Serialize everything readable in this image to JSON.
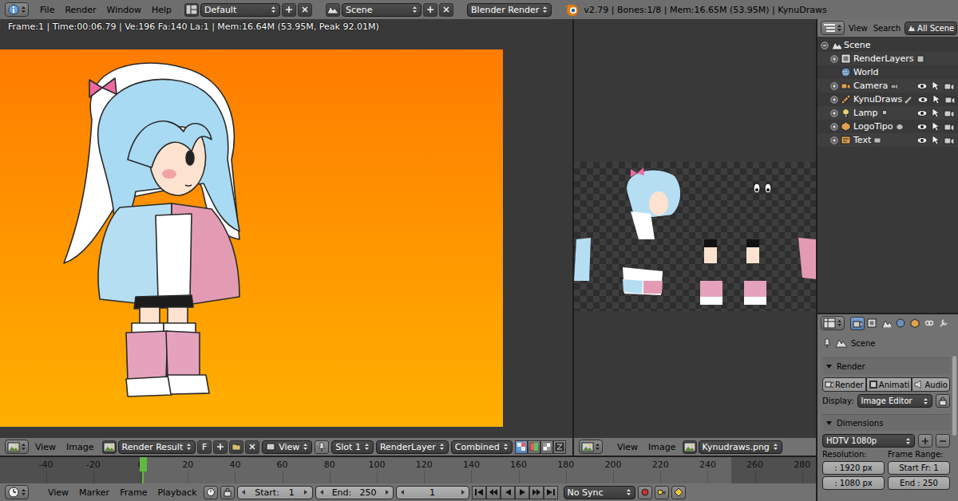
{
  "info_header": {
    "menus": [
      "File",
      "Render",
      "Window",
      "Help"
    ],
    "layout": "Default",
    "scene": "Scene",
    "engine": "Blender Render",
    "stats": "v2.79 | Bones:1/8 | Mem:16.65M (53.95M) | KynuDraws"
  },
  "render_editor": {
    "overlay": "Frame:1 | Time:00:06.79 | Ve:196 Fa:140 La:1 | Mem:16.64M (53.95M, Peak 92.01M)",
    "menus": [
      "View",
      "Image"
    ],
    "image": "Render Result",
    "fake_user": "F",
    "view": "View",
    "slot": "Slot 1",
    "layer": "RenderLayer",
    "pass": "Combined",
    "channels": [
      {
        "selected": true
      },
      {
        "selected": false
      },
      {
        "selected": false
      },
      {
        "selected": false
      }
    ]
  },
  "texture_editor": {
    "menus": [
      "View",
      "Image"
    ],
    "image": "Kynudraws.png"
  },
  "outliner": {
    "menus": [
      "View",
      "Search"
    ],
    "display": "All Scene",
    "items": [
      {
        "label": "Scene",
        "kind": "scene",
        "expanded": true
      },
      {
        "label": "RenderLayers",
        "kind": "render-layers",
        "expanded": false
      },
      {
        "label": "World",
        "kind": "world"
      },
      {
        "label": "Camera",
        "kind": "camera",
        "expanded": false,
        "visible": true,
        "selectable": true,
        "renderable": true
      },
      {
        "label": "KynuDraws",
        "kind": "armature",
        "expanded": false,
        "visible": true,
        "selectable": true,
        "renderable": true
      },
      {
        "label": "Lamp",
        "kind": "lamp",
        "expanded": false,
        "visible": true,
        "selectable": true,
        "renderable": true
      },
      {
        "label": "LogoTipo",
        "kind": "mesh",
        "expanded": false,
        "visible": true,
        "selectable": true,
        "renderable": true
      },
      {
        "label": "Text",
        "kind": "text",
        "expanded": false,
        "visible": true,
        "selectable": true,
        "renderable": true
      }
    ]
  },
  "properties": {
    "tabs": [
      {
        "selected": true
      },
      {
        "selected": false
      },
      {
        "selected": false
      },
      {
        "selected": false
      },
      {
        "selected": false
      },
      {
        "selected": false
      },
      {
        "selected": false
      }
    ],
    "context": "Scene",
    "render_panel": {
      "title": "Render",
      "expanded": true,
      "buttons": [
        "Render",
        "Animati",
        "Audio"
      ],
      "display_label": "Display:",
      "display": "Image Editor"
    },
    "dimensions_panel": {
      "title": "Dimensions",
      "expanded": true,
      "preset": "HDTV 1080p",
      "resolution_label": "Resolution:",
      "frame_range_label": "Frame Range:",
      "resolution_x": ": 1920 px",
      "resolution_y": ": 1080 px",
      "frame_start": "Start Fr: 1",
      "frame_end": "End : 250"
    }
  },
  "timeline": {
    "ticks": [
      "-40",
      "-20",
      "0",
      "20",
      "40",
      "60",
      "80",
      "100",
      "120",
      "140",
      "160",
      "180",
      "200",
      "220",
      "240",
      "260",
      "280"
    ],
    "menus": [
      "View",
      "Marker",
      "Frame",
      "Playback"
    ],
    "start_label": "Start:",
    "start": "1",
    "end_label": "End:",
    "end": "250",
    "frame": "1",
    "sync": "No Sync"
  }
}
